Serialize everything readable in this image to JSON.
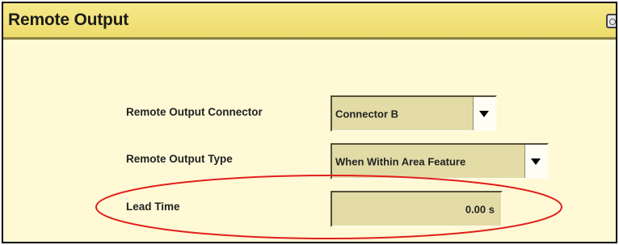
{
  "window": {
    "title": "Remote Output",
    "title_icon": "camera-icon"
  },
  "form": {
    "connector": {
      "label": "Remote Output Connector",
      "value": "Connector B"
    },
    "type": {
      "label": "Remote Output Type",
      "value": "When Within Area Feature"
    },
    "lead_time": {
      "label": "Lead Time",
      "value": "0.00 s"
    }
  },
  "colors": {
    "title_bar": "#eddc6b",
    "panel_background": "#fff9d6",
    "field_background": "#e3dba6",
    "highlight_ellipse": "#e0201c"
  }
}
